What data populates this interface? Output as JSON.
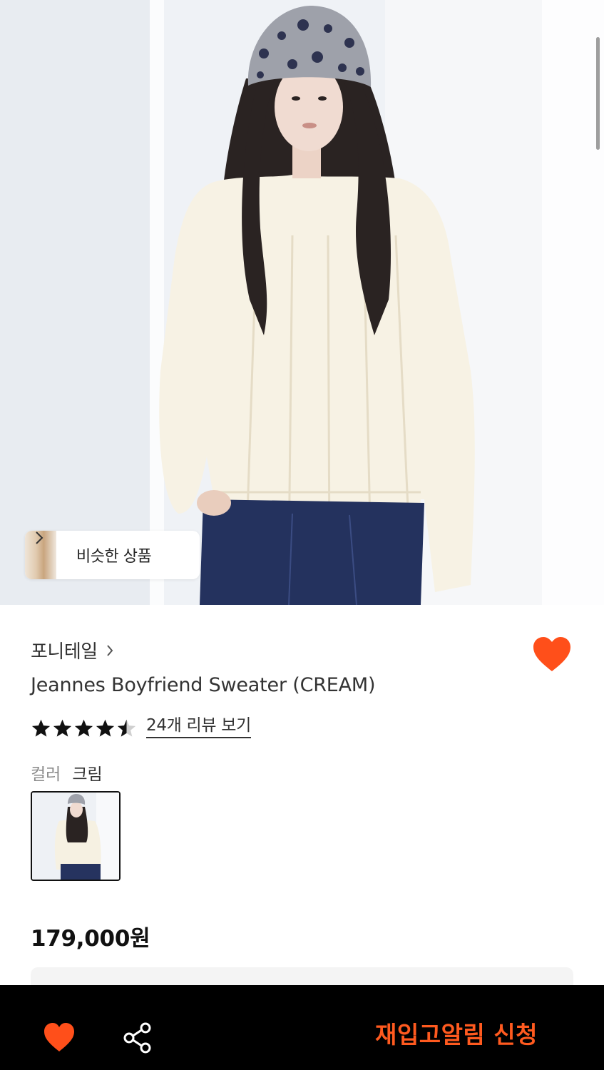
{
  "hero": {
    "similar_products_label": "비슷한 상품"
  },
  "product": {
    "brand": "포니테일",
    "title": "Jeannes Boyfriend Sweater (CREAM)",
    "rating": 4.5,
    "rating_max": 5,
    "review_link": "24개 리뷰 보기",
    "color_label": "컬러",
    "color_value": "크림",
    "price": "179,000원",
    "liked": true
  },
  "bottom_bar": {
    "restock_button": "재입고알림 신청"
  },
  "icons": {
    "heart": "heart-icon",
    "share": "share-icon",
    "chevron": "chevron-right-icon",
    "star": "star-icon"
  },
  "colors": {
    "accent": "#FF4F1A",
    "bottom_bar": "#000000",
    "text": "#333333"
  }
}
